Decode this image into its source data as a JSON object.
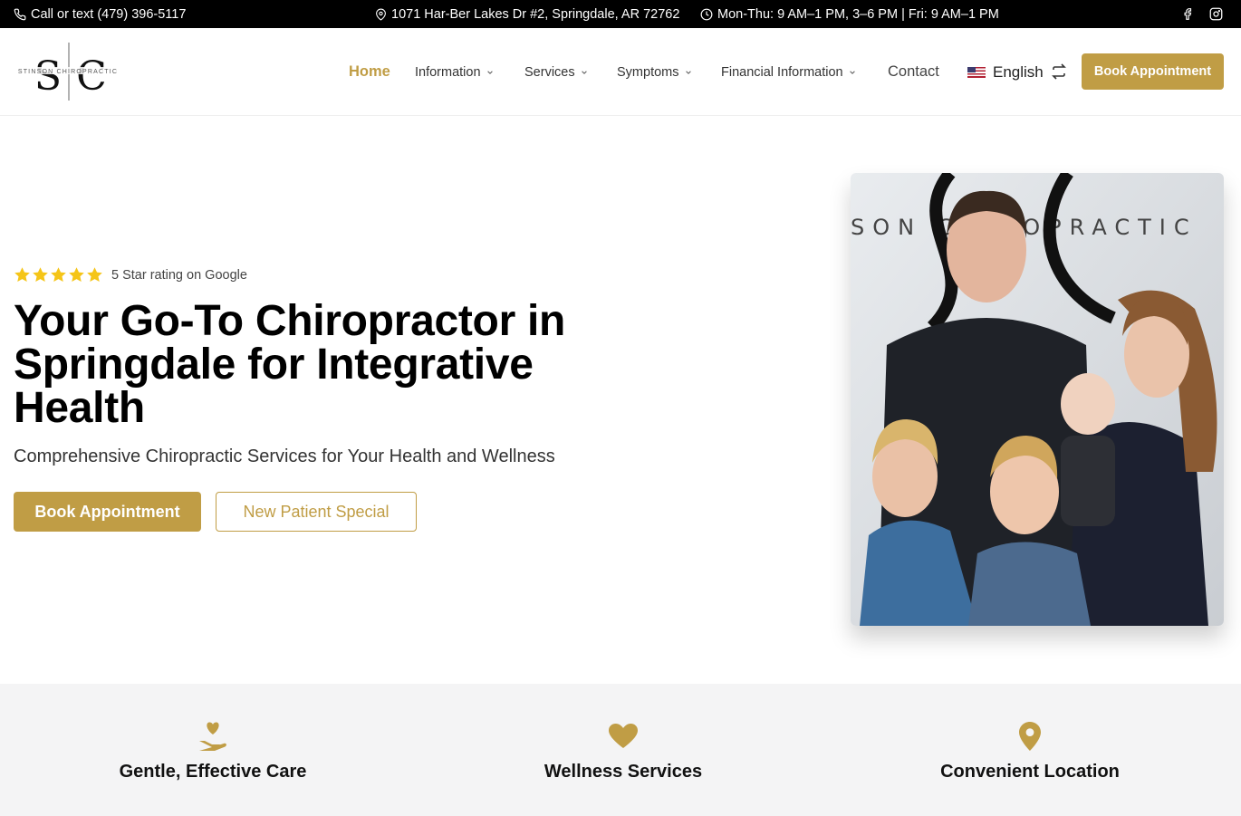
{
  "topbar": {
    "phone": "Call or text (479) 396-5117",
    "address": "1071 Har-Ber Lakes Dr #2, Springdale, AR 72762",
    "hours": "Mon-Thu: 9 AM–1 PM, 3–6 PM | Fri: 9 AM–1 PM",
    "social": [
      "facebook-icon",
      "instagram-icon"
    ]
  },
  "header": {
    "logo_text": "STINSON CHIROPRACTIC",
    "logo_letters": [
      "S",
      "C"
    ],
    "nav": {
      "home": "Home",
      "information": "Information",
      "services": "Services",
      "symptoms": "Symptoms",
      "financial": "Financial Information",
      "contact": "Contact"
    },
    "language": "English",
    "cta": "Book Appointment"
  },
  "hero": {
    "star_count": 5,
    "rating": "5 Star rating on Google",
    "title": "Your Go-To Chiropractor in Springdale for Integrative Health",
    "subtitle": "Comprehensive Chiropractic Services for Your Health and Wellness",
    "primary_button": "Book Appointment",
    "secondary_button": "New Patient Special",
    "photo_wall_text": "SON CHIROPRACTIC"
  },
  "features": [
    {
      "icon": "hand-heart-icon",
      "title": "Gentle, Effective Care"
    },
    {
      "icon": "heart-icon",
      "title": "Wellness Services"
    },
    {
      "icon": "location-pin-icon",
      "title": "Convenient Location"
    }
  ],
  "colors": {
    "accent": "#c09d45",
    "topbar_bg": "#000000",
    "star": "#f5c518",
    "features_bg": "#f4f4f5"
  }
}
